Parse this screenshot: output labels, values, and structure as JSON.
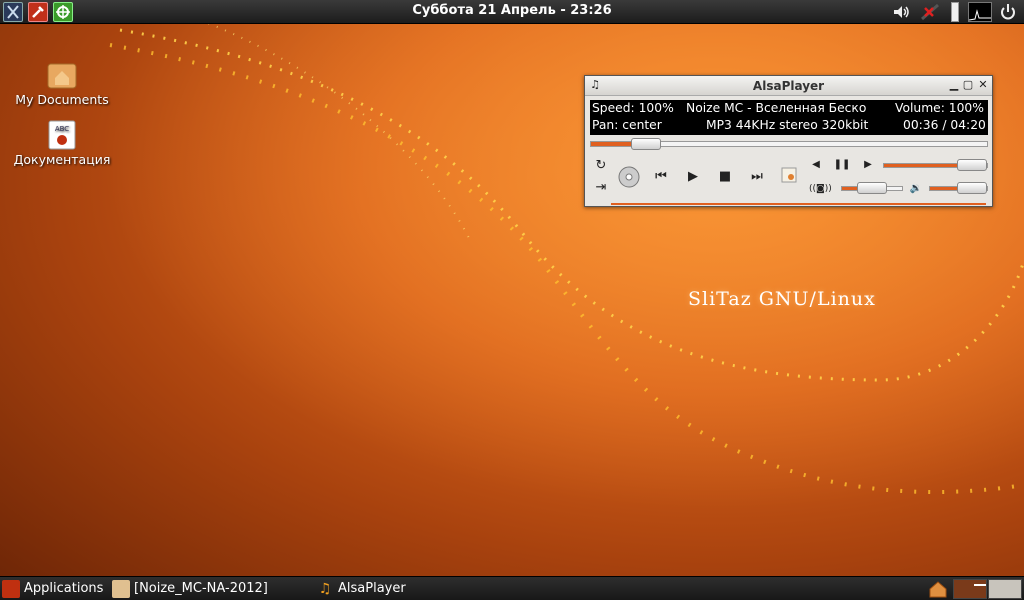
{
  "top_panel": {
    "clock": "Суббота 21 Апрель - 23:26",
    "launchers": [
      {
        "name": "x-terminal-icon"
      },
      {
        "name": "tools-icon"
      },
      {
        "name": "network-icon"
      }
    ],
    "tray": [
      "volume-icon",
      "network-status-icon",
      "battery-icon",
      "cpu-monitor-icon",
      "power-icon"
    ]
  },
  "desktop": {
    "icons": [
      {
        "label": "My Documents",
        "icon": "home-folder-icon"
      },
      {
        "label": "Документация",
        "icon": "documentation-icon"
      }
    ],
    "branding": "SliTaz GNU/Linux"
  },
  "alsaplayer": {
    "title": "AlsaPlayer",
    "speed": "Speed: 100%",
    "track": "Noize MC - Вселенная Беско",
    "volume": "Volume: 100%",
    "pan": "Pan: center",
    "format": "MP3 44KHz stereo 320kbit",
    "time": "00:36 / 04:20",
    "seek_fraction": 0.14,
    "speed_fraction": 0.85,
    "balance_fraction": 0.5,
    "volume_fraction": 1.0,
    "accent": "#e06020"
  },
  "bottom_panel": {
    "applications": "Applications",
    "tasks": [
      {
        "label": "[Noize_MC-NA-2012]",
        "icon": "folder-icon"
      },
      {
        "label": "AlsaPlayer",
        "icon": "music-icon"
      }
    ]
  }
}
